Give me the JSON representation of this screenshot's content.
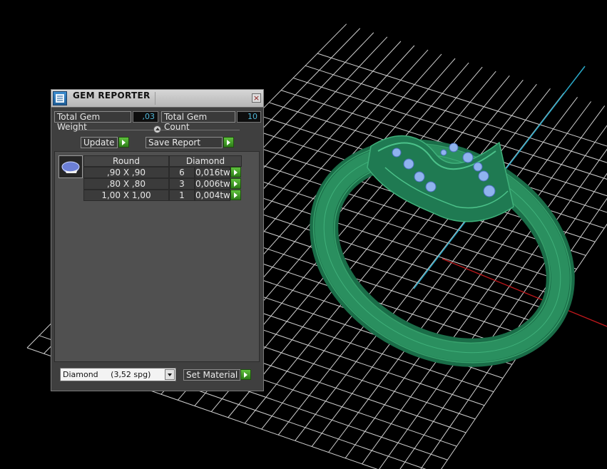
{
  "panel": {
    "title": "GEM REPORTER",
    "close_symbol": "×",
    "total_weight_label": "Total Gem Weight",
    "total_weight_value": ",03",
    "total_count_label": "Total Gem Count",
    "total_count_value": "10",
    "update_label": "Update",
    "save_report_label": "Save Report",
    "table": {
      "headers": [
        "Round",
        "Diamond"
      ],
      "rows": [
        {
          "size": ",90 X ,90",
          "count": "6",
          "weight": "0,016tw"
        },
        {
          "size": ",80 X ,80",
          "count": "3",
          "weight": "0,006tw"
        },
        {
          "size": "1,00 X 1,00",
          "count": "1",
          "weight": "0,004tw"
        }
      ]
    },
    "material_selected": "Diamond     (3,52 spg)",
    "set_material_label": "Set Material"
  },
  "colors": {
    "grid": "#cfcfcf",
    "axis_x": "#c0181c",
    "axis_y": "#2aa9c8",
    "ring": "#1f7a52",
    "gems": "#8fb3ee",
    "go_button": "#3ea326"
  },
  "icons": [
    "gem-reporter-icon",
    "close-icon",
    "gem-thumbnail-icon",
    "dropdown-arrow-icon",
    "play-arrow-icon"
  ]
}
